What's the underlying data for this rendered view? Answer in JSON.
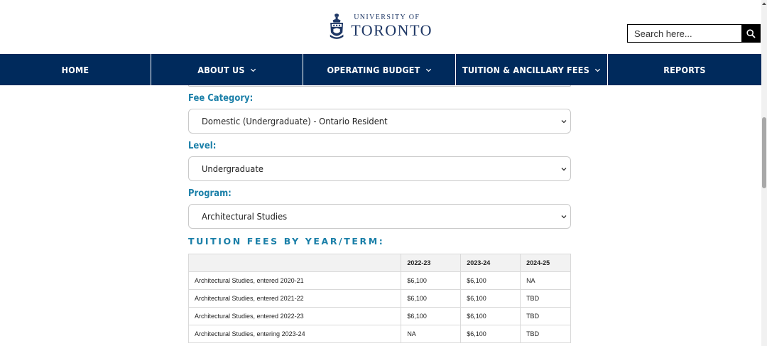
{
  "header": {
    "logo_small": "UNIVERSITY OF",
    "logo_big": "TORONTO",
    "search_placeholder": "Search here..."
  },
  "nav": {
    "items": [
      {
        "label": "HOME",
        "dropdown": false
      },
      {
        "label": "ABOUT US",
        "dropdown": true
      },
      {
        "label": "OPERATING BUDGET",
        "dropdown": true
      },
      {
        "label": "TUITION & ANCILLARY FEES",
        "dropdown": true
      },
      {
        "label": "REPORTS",
        "dropdown": false
      }
    ]
  },
  "form": {
    "fee_category_label": "Fee Category:",
    "fee_category_value": "Domestic (Undergraduate) - Ontario Resident",
    "level_label": "Level:",
    "level_value": "Undergraduate",
    "program_label": "Program:",
    "program_value": "Architectural Studies"
  },
  "fees": {
    "title": "TUITION FEES BY YEAR/TERM:",
    "columns": [
      "",
      "2022-23",
      "2023-24",
      "2024-25"
    ],
    "rows": [
      [
        "Architectural Studies, entered 2020-21",
        "$6,100",
        "$6,100",
        "NA"
      ],
      [
        "Architectural Studies, entered 2021-22",
        "$6,100",
        "$6,100",
        "TBD"
      ],
      [
        "Architectural Studies, entered 2022-23",
        "$6,100",
        "$6,100",
        "TBD"
      ],
      [
        "Architectural Studies, entering 2023-24",
        "NA",
        "$6,100",
        "TBD"
      ]
    ]
  },
  "colors": {
    "nav_bg": "#002a5c",
    "accent": "#1a7fa8",
    "brand": "#1e3765"
  }
}
